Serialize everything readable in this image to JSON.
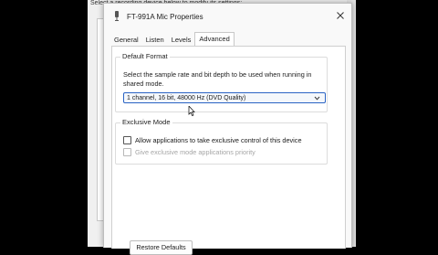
{
  "background_window": {
    "partial_text": "Select a recording device below to modify its settings:"
  },
  "dialog": {
    "title": "FT-991A Mic Properties",
    "tabs": [
      {
        "label": "General",
        "active": false
      },
      {
        "label": "Listen",
        "active": false
      },
      {
        "label": "Levels",
        "active": false
      },
      {
        "label": "Advanced",
        "active": true
      }
    ],
    "default_format": {
      "legend": "Default Format",
      "description": "Select the sample rate and bit depth to be used when running in shared mode.",
      "selected_format": "1 channel, 16 bit, 48000 Hz (DVD Quality)"
    },
    "exclusive_mode": {
      "legend": "Exclusive Mode",
      "allow_exclusive_label": "Allow applications to take exclusive control of this device",
      "allow_exclusive_checked": false,
      "priority_label": "Give exclusive mode applications priority",
      "priority_checked": false,
      "priority_enabled": false
    },
    "restore_defaults_label": "Restore Defaults"
  },
  "colors": {
    "accent": "#2a63c4",
    "dialog_bg": "#f9f9f9",
    "panel_bg": "#ffffff",
    "disabled_text": "#a6a6a6"
  },
  "icons": {
    "title_icon": "microphone-icon",
    "close": "close-icon",
    "dropdown": "chevron-down-icon"
  }
}
